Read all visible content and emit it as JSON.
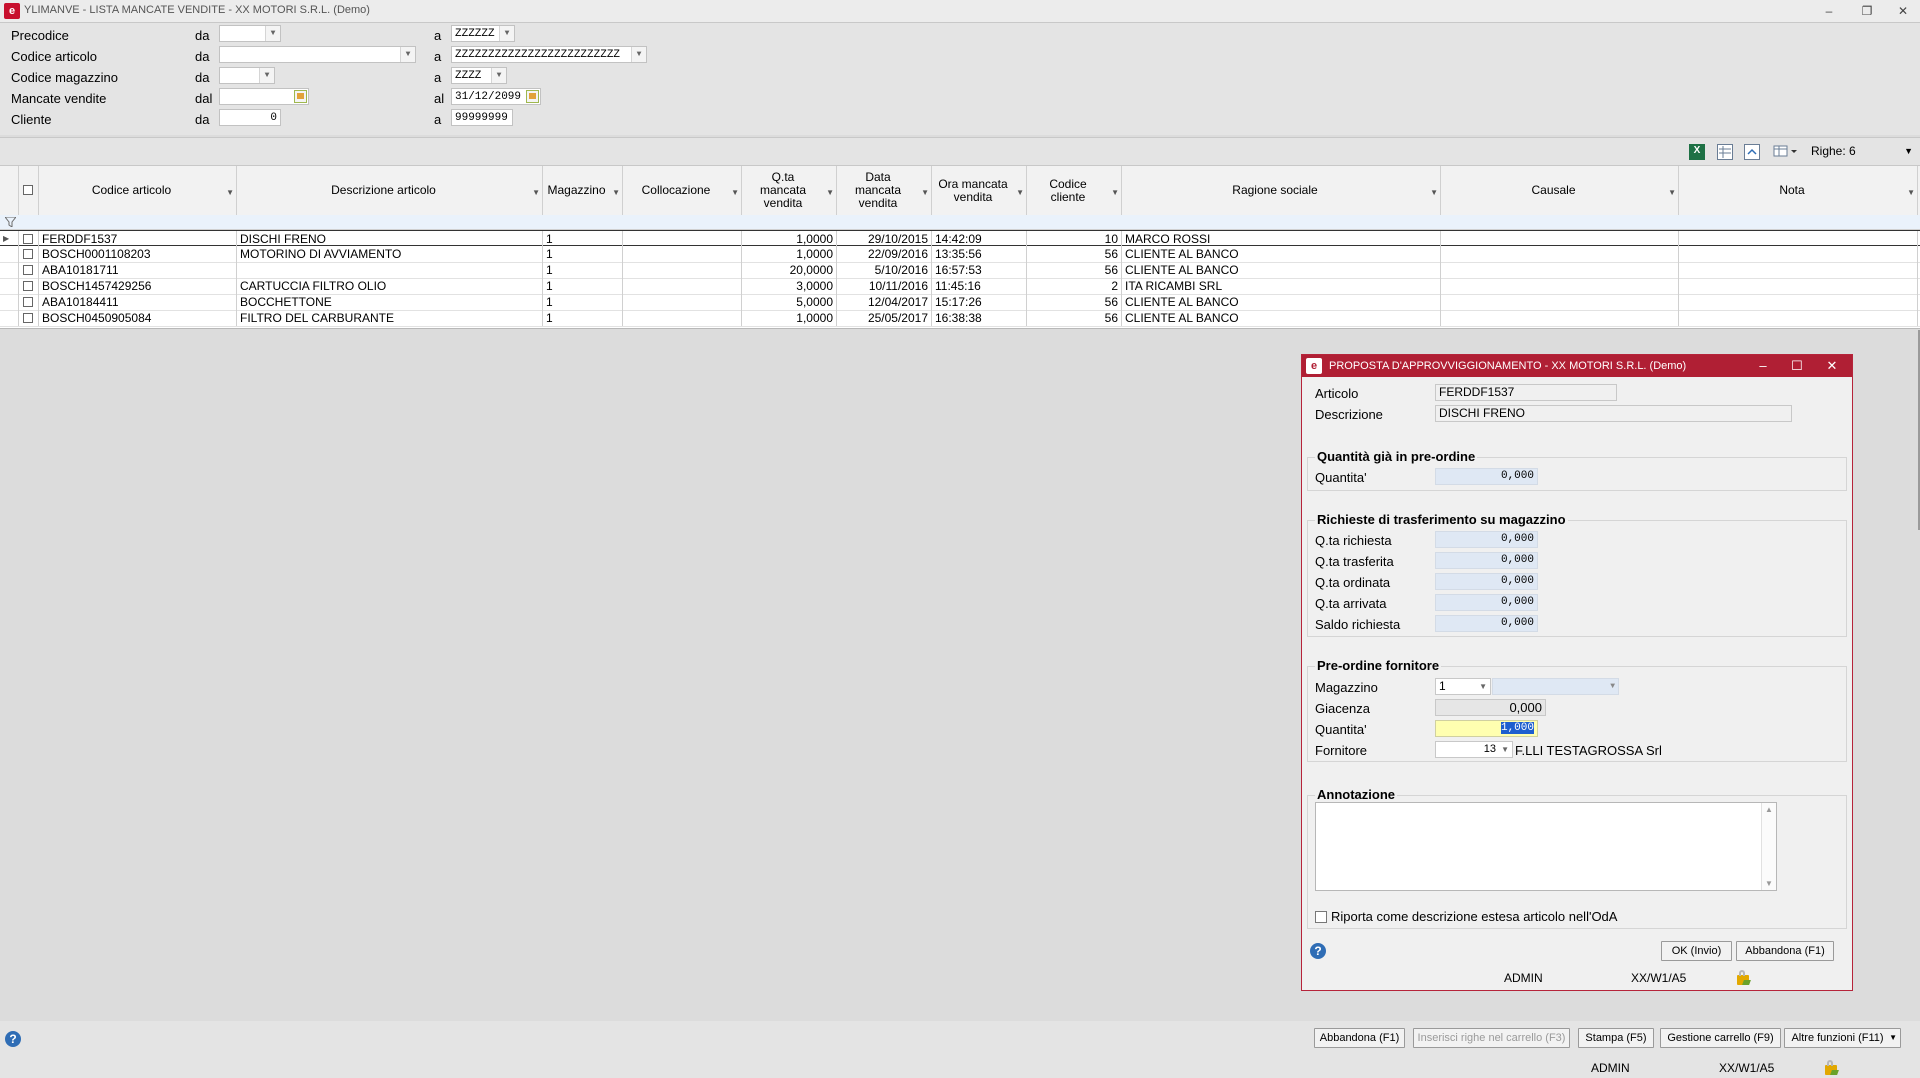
{
  "window": {
    "title": "YLIMANVE - LISTA MANCATE VENDITE - XX  MOTORI S.R.L.  (Demo)",
    "minimize": "–",
    "restore": "❐",
    "close": "✕"
  },
  "filters": [
    {
      "label": "Precodice",
      "from_label": "da",
      "from_value": "",
      "to_label": "a",
      "to_value": "ZZZZZZ"
    },
    {
      "label": "Codice articolo",
      "from_label": "da",
      "from_value": "",
      "to_label": "a",
      "to_value": "ZZZZZZZZZZZZZZZZZZZZZZZZZ"
    },
    {
      "label": "Codice magazzino",
      "from_label": "da",
      "from_value": "",
      "to_label": "a",
      "to_value": "ZZZZ"
    },
    {
      "label": "Mancate vendite",
      "from_label": "dal",
      "from_value": "",
      "to_label": "al",
      "to_value": "31/12/2099"
    },
    {
      "label": "Cliente",
      "from_label": "da",
      "from_value": "0",
      "to_label": "a",
      "to_value": "99999999"
    }
  ],
  "toolbar": {
    "rows_label": "Righe: 6",
    "icons": [
      "excel-icon",
      "grid-layout-icon",
      "refresh-icon",
      "columns-icon"
    ]
  },
  "grid": {
    "columns": [
      "Codice articolo",
      "Descrizione articolo",
      "Magazzino",
      "Collocazione",
      "Q.ta mancata vendita",
      "Data mancata vendita",
      "Ora mancata vendita",
      "Codice cliente",
      "Ragione sociale",
      "Causale",
      "Nota"
    ],
    "rows": [
      [
        "FERDDF1537",
        "DISCHI FRENO",
        "1",
        "",
        "1,0000",
        "29/10/2015",
        "14:42:09",
        "10",
        "MARCO ROSSI",
        "",
        ""
      ],
      [
        "BOSCH0001108203",
        "MOTORINO DI AVVIAMENTO",
        "1",
        "",
        "1,0000",
        "22/09/2016",
        "13:35:56",
        "56",
        "CLIENTE AL BANCO",
        "",
        ""
      ],
      [
        "ABA10181711",
        "",
        "1",
        "",
        "20,0000",
        "5/10/2016",
        "16:57:53",
        "56",
        "CLIENTE AL BANCO",
        "",
        ""
      ],
      [
        "BOSCH1457429256",
        "CARTUCCIA FILTRO OLIO",
        "1",
        "",
        "3,0000",
        "10/11/2016",
        "11:45:16",
        "2",
        "ITA RICAMBI SRL",
        "",
        ""
      ],
      [
        "ABA10184411",
        "BOCCHETTONE",
        "1",
        "",
        "5,0000",
        "12/04/2017",
        "15:17:26",
        "56",
        "CLIENTE AL BANCO",
        "",
        ""
      ],
      [
        "BOSCH0450905084",
        "FILTRO DEL CARBURANTE",
        "1",
        "",
        "1,0000",
        "25/05/2017",
        "16:38:38",
        "56",
        "CLIENTE AL BANCO",
        "",
        ""
      ]
    ]
  },
  "dialog": {
    "title": "PROPOSTA D'APPROVVIGGIONAMENTO - XX  MOTORI S.R.L.  (Demo)",
    "articolo_label": "Articolo",
    "articolo_value": "FERDDF1537",
    "descrizione_label": "Descrizione",
    "descrizione_value": "DISCHI FRENO",
    "preordine_group": "Quantità già in pre-ordine",
    "quantita_label": "Quantita'",
    "quantita_value": "0,000",
    "trasferimento_group": "Richieste di trasferimento su magazzino",
    "trasf_rows": [
      {
        "label": "Q.ta richiesta",
        "value": "0,000"
      },
      {
        "label": "Q.ta trasferita",
        "value": "0,000"
      },
      {
        "label": "Q.ta ordinata",
        "value": "0,000"
      },
      {
        "label": "Q.ta arrivata",
        "value": "0,000"
      },
      {
        "label": "Saldo richiesta",
        "value": "0,000"
      }
    ],
    "fornitore_group": "Pre-ordine fornitore",
    "magazzino_label": "Magazzino",
    "magazzino_value": "1",
    "giacenza_label": "Giacenza",
    "giacenza_value": "0,000",
    "pf_quantita_label": "Quantita'",
    "pf_quantita_value": "1,000",
    "fornitore_label": "Fornitore",
    "fornitore_code": "13",
    "fornitore_name": "F.LLI TESTAGROSSA Srl",
    "annotazione_group": "Annotazione",
    "annotazione_value": "",
    "riporta_label": "Riporta come descrizione estesa articolo nell'OdA",
    "ok_button": "OK (Invio)",
    "abbandona_button": "Abbandona (F1)",
    "status_user": "ADMIN",
    "status_terminal": "XX/W1/A5"
  },
  "bottom": {
    "buttons": [
      "Abbandona (F1)",
      "Inserisci righe nel carrello (F3)",
      "Stampa (F5)",
      "Gestione carrello (F9)",
      "Altre funzioni (F11)"
    ],
    "status_user": "ADMIN",
    "status_terminal": "XX/W1/A5"
  },
  "colors": {
    "dialog_title_bar": "#b01f34",
    "readonly_field": "#dfe8f4",
    "active_field": "#ffffb0"
  }
}
